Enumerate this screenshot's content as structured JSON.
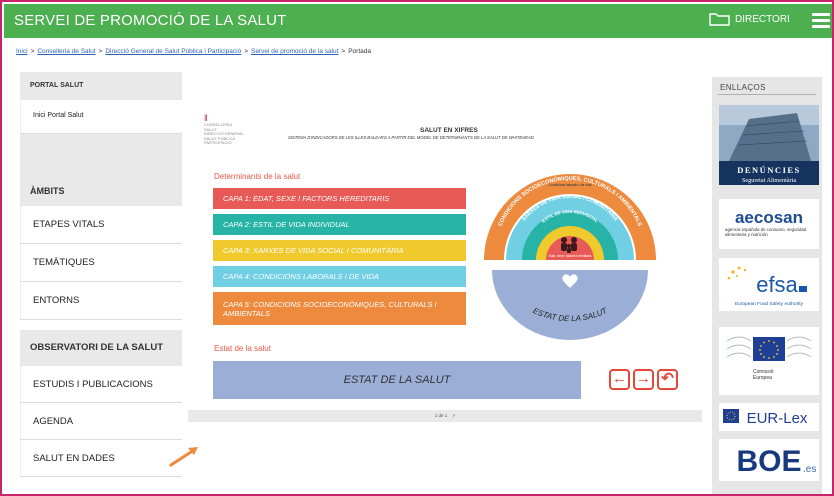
{
  "header": {
    "site_title": "SERVEI DE PROMOCIÓ DE LA SALUT",
    "directori_label": "DIRECTORI"
  },
  "breadcrumb": {
    "items": [
      "Inici",
      "Conselleria de Salut",
      "Direcció General de Salut Pública i Participació",
      "Servei de promoció de la salut"
    ],
    "current": "Portada",
    "separator": ">"
  },
  "sidebar": {
    "portal_heading": "PORTAL SALUT",
    "portal_item": "Inici Portal Salut",
    "ambits_heading": "ÀMBITS",
    "ambits_items": [
      "ETAPES VITALS",
      "TEMÀTIQUES",
      "ENTORNS"
    ],
    "observatori_heading": "OBSERVATORI DE LA SALUT",
    "observatori_items": [
      "ESTUDIS I PUBLICACIONS",
      "AGENDA",
      "SALUT EN DADES"
    ]
  },
  "slide": {
    "logo_lines": [
      "CONSELLERIA",
      "SALUT",
      "DIRECCIÓ GENERAL",
      "SALUT PÚBLICA",
      "PARTICIPACIÓ"
    ],
    "title": "SALUT EN XIFRES",
    "subtitle": "SISTEMA D'INDICADORS DE LES ILLES BALEARS A PARTIR DEL MODEL DE DETERMINANTS DE LA SALUT DE WHITEHEAD",
    "determinants_label": "Determinants de la salut",
    "capes": [
      "CAPA 1: EDAT, SEXE I FACTORS HEREDITARIS",
      "CAPA 2: ESTIL DE VIDA INDIVIDUAL",
      "CAPA 3: XARXES DE VIDA SOCIAL I COMUNITÀRIA",
      "CAPA 4: CONDICIONS LABORALS I DE VIDA",
      "CAPA 5: CONDICIONS SOCIOECONÒMIQUES, CULTURALS I AMBIENTALS"
    ],
    "estat_label": "Estat de la salut",
    "estat_box": "ESTAT DE LA SALUT",
    "ring_texts": {
      "outer": "CONDICIONS SOCIOECONÒMIQUES, CULTURALS I AMBIENTALS",
      "middle": "XARXES DE VIDA SOCIAL I COMUNITÀRIA",
      "inner": "ESTIL DE VIDA INDIVIDUAL",
      "core": "Edat, sexe i factors hereditaris",
      "work": "Condicions laborals i de vida",
      "bottom": "ESTAT DE LA SALUT"
    },
    "pager": "1 de 1",
    "pager_next": ">"
  },
  "links": {
    "heading": "ENLLAÇOS",
    "denuncies_1": "DENÚNCIES",
    "denuncies_2": "Seguretat Alimentària",
    "aecosan": "aecosan",
    "aecosan_sub": "agencia española de consumo, seguridad alimentaria y nutrición",
    "efsa": "efsa",
    "efsa_sub": "European Food Safety Authority",
    "ce_1": "Comissió",
    "ce_2": "Europea",
    "eurlex": "EUR-Lex",
    "boe": "BOE",
    "boe_suffix": ".es"
  },
  "colors": {
    "header": "#4caf50",
    "frame": "#c8246a",
    "capa1": "#e85a56",
    "capa2": "#27b4a6",
    "capa3": "#f0c92d",
    "capa4": "#71cfe4",
    "capa5": "#ee8a3e",
    "estat": "#9aaed6",
    "accent_red": "#e7473a"
  },
  "icons": [
    "folder-icon",
    "hamburger-menu-icon",
    "arrow-left-icon",
    "arrow-right-icon",
    "reset-icon",
    "pointer-arrow-icon",
    "heart-icon",
    "family-icon"
  ]
}
